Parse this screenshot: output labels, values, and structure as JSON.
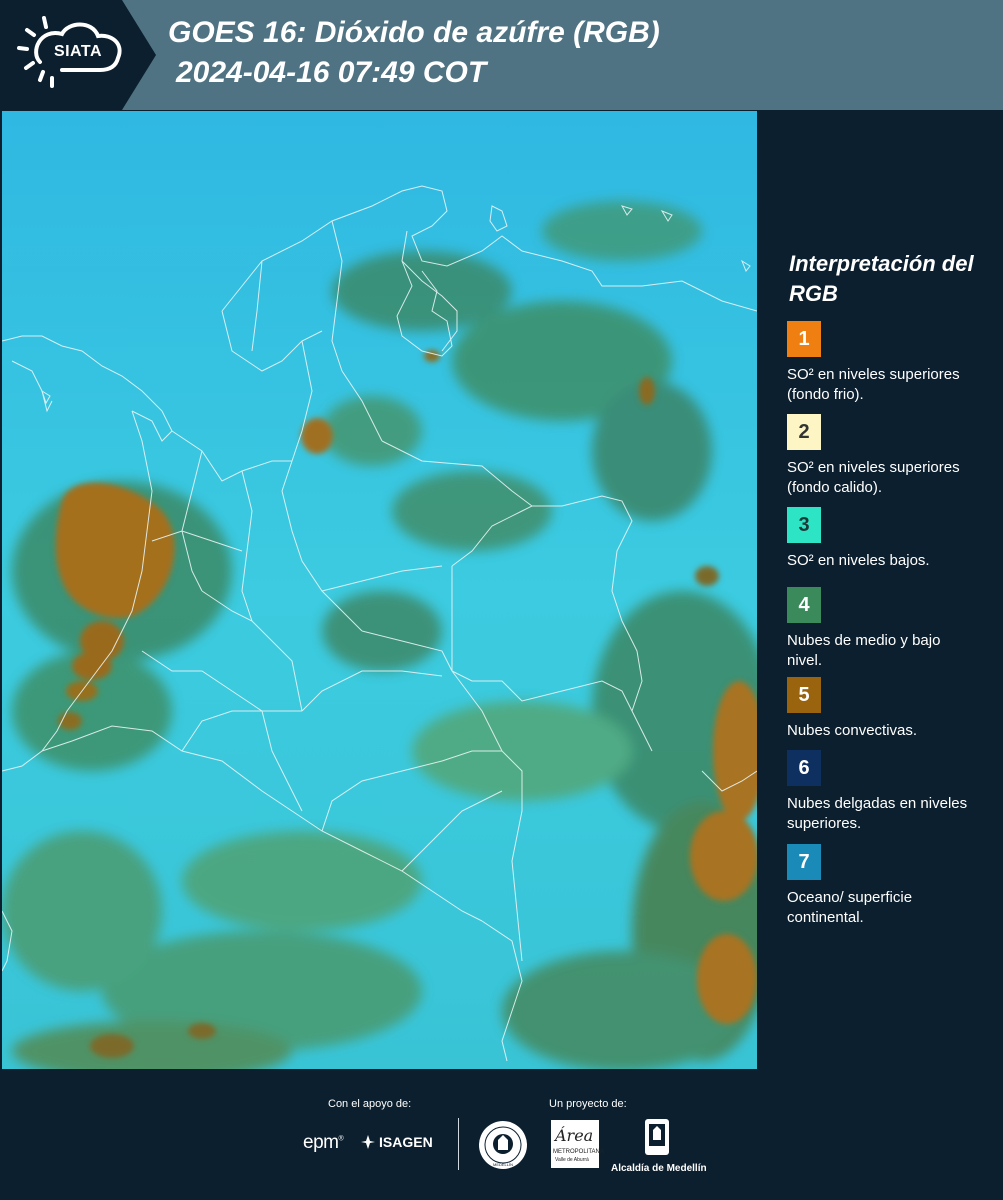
{
  "header": {
    "logo_text": "SIATA",
    "title": "GOES 16: Dióxido de azúfre (RGB)",
    "datetime": "2024-04-16 07:49 COT"
  },
  "legend": {
    "title": "Interpretación del RGB",
    "items": [
      {
        "number": "1",
        "text": "SO² en niveles superiores (fondo frio).",
        "color": "#f07f12",
        "text_color": "#ffffff"
      },
      {
        "number": "2",
        "text": "SO² en niveles superiores (fondo calido).",
        "color": "#fdf6c4",
        "text_color": "#333333"
      },
      {
        "number": "3",
        "text": "SO² en niveles bajos.",
        "color": "#2de5c4",
        "text_color": "#1a3a3a"
      },
      {
        "number": "4",
        "text": "Nubes de medio y bajo nivel.",
        "color": "#3a8a5c",
        "text_color": "#ffffff"
      },
      {
        "number": "5",
        "text": "Nubes convectivas.",
        "color": "#9a640e",
        "text_color": "#ffffff"
      },
      {
        "number": "6",
        "text": "Nubes delgadas en niveles superiores.",
        "color": "#0e3060",
        "text_color": "#ffffff"
      },
      {
        "number": "7",
        "text": "Oceano/ superficie continental.",
        "color": "#1a8ab8",
        "text_color": "#ffffff"
      }
    ]
  },
  "footer": {
    "support_label": "Con el apoyo de:",
    "project_label": "Un proyecto de:",
    "sponsor_epm": "epm",
    "sponsor_isagen": "ISAGEN",
    "amva_word": "Área",
    "amva_sub1": "METROPOLITANA",
    "amva_sub2": "Valle de Aburrá",
    "seal_text": "MEDELLÍN",
    "alcaldia": "Alcaldía de Medellín"
  },
  "colors": {
    "header_bg": "#4f7383",
    "panel_bg": "#0c1f2e",
    "sky_cyan": "#37c4de",
    "cloud_green": "#3e9a70",
    "cloud_olive": "#5c7c3a",
    "convective_brown": "#a0701c"
  }
}
